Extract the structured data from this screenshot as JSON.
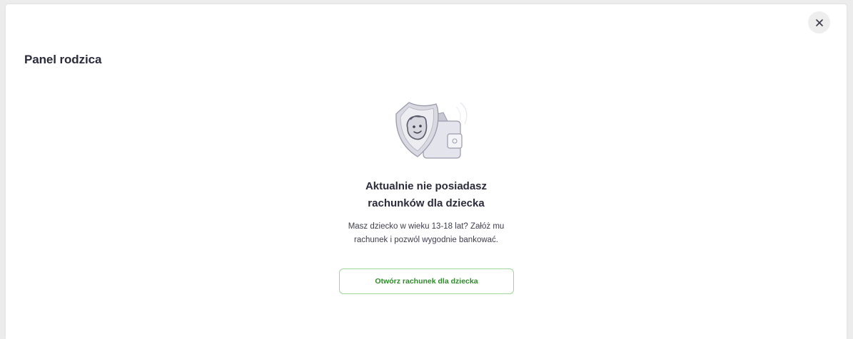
{
  "panel": {
    "title": "Panel rodzica",
    "close_icon": "close-icon"
  },
  "empty_state": {
    "illustration_icon": "shield-wallet-child-icon",
    "heading_line1": "Aktualnie nie posiadasz",
    "heading_line2": "rachunków dla dziecka",
    "description_line1": "Masz dziecko w wieku 13-18 lat? Załóż mu",
    "description_line2": "rachunek i pozwól wygodnie bankować.",
    "cta_label": "Otwórz rachunek dla dziecka"
  },
  "colors": {
    "accent": "#2e8b2a",
    "button_border": "#9fd49a",
    "title": "#2b2b3c"
  }
}
